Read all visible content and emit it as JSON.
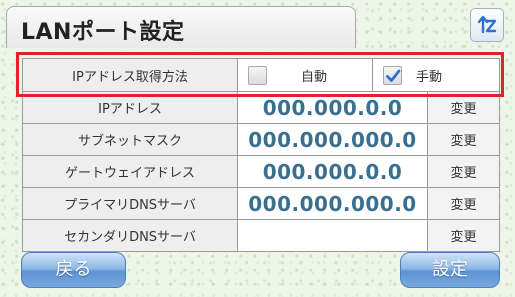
{
  "title": "LANポート設定",
  "corner_icon": "sort-toggle-icon",
  "rows": {
    "ip_method": {
      "label": "IPアドレス取得方法",
      "auto_label": "自動",
      "auto_checked": false,
      "manual_label": "手動",
      "manual_checked": true
    },
    "ip_address": {
      "label": "IPアドレス",
      "value": "000.000.0.0",
      "change": "変更"
    },
    "subnet_mask": {
      "label": "サブネットマスク",
      "value": "000.000.000.0",
      "change": "変更"
    },
    "gateway": {
      "label": "ゲートウェイアドレス",
      "value": "000.000.0.0",
      "change": "変更"
    },
    "primary_dns": {
      "label": "プライマリDNSサーバ",
      "value": "000.000.000.0",
      "change": "変更"
    },
    "secondary_dns": {
      "label": "セカンダリDNSサーバ",
      "value": "",
      "change": "変更"
    }
  },
  "buttons": {
    "back": "戻る",
    "set": "設定"
  },
  "colors": {
    "highlight": "#e0232a",
    "value_text": "#3a6f8f",
    "button_blue": "#5d93d3",
    "check_blue": "#2f6fd0"
  }
}
